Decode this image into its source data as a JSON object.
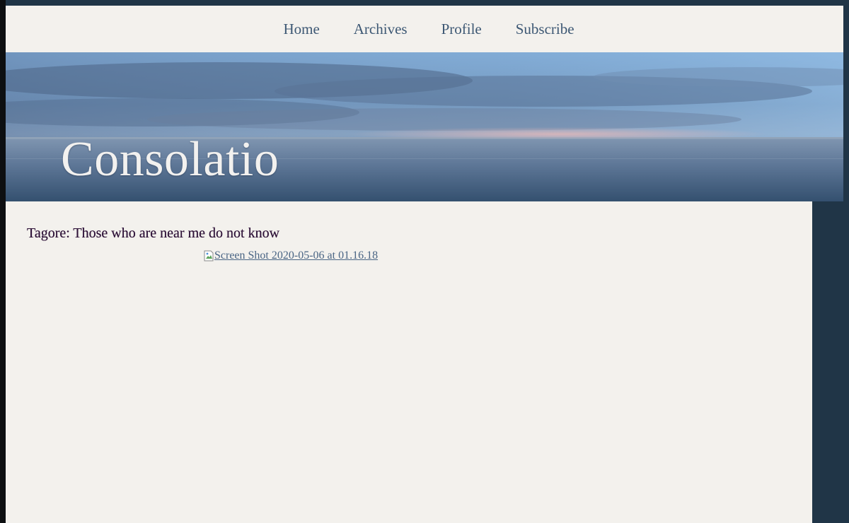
{
  "nav": {
    "items": [
      {
        "label": "Home"
      },
      {
        "label": "Archives"
      },
      {
        "label": "Profile"
      },
      {
        "label": "Subscribe"
      }
    ]
  },
  "header": {
    "site_title": "Consolatio"
  },
  "post": {
    "title": "Tagore: Those who are near me do not know",
    "image_alt": "Screen Shot 2020-05-06 at 01.16.18"
  },
  "colors": {
    "page_background": "#203547",
    "content_background": "#f3f1ed",
    "nav_link": "#3d5874",
    "post_title": "#2e1238",
    "link": "#4a6584"
  },
  "icons": {
    "broken_image": "broken-image-icon"
  }
}
